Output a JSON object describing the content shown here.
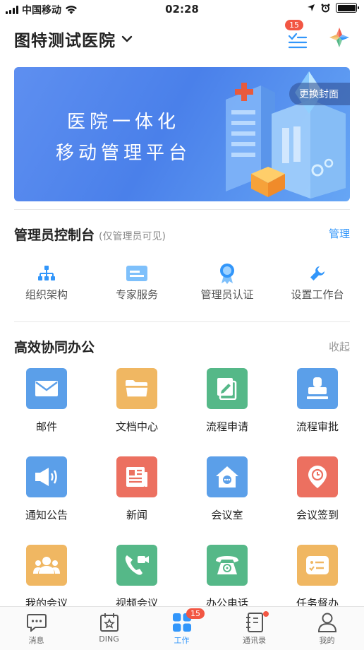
{
  "status_bar": {
    "carrier": "中国移动",
    "time": "02:28"
  },
  "header": {
    "org_name": "图特测试医院",
    "todo_badge": "15"
  },
  "banner": {
    "title_line1": "医院一体化",
    "title_line2": "移动管理平台",
    "change_cover": "更换封面"
  },
  "admin": {
    "title": "管理员控制台",
    "subtitle": "(仅管理员可见)",
    "manage": "管理",
    "items": [
      {
        "label": "组织架构",
        "icon": "org-chart-icon"
      },
      {
        "label": "专家服务",
        "icon": "card-icon"
      },
      {
        "label": "管理员认证",
        "icon": "badge-icon"
      },
      {
        "label": "设置工作台",
        "icon": "wrench-icon"
      }
    ]
  },
  "collab": {
    "title": "高效协同办公",
    "collapse": "收起",
    "apps": [
      {
        "label": "邮件",
        "icon": "mail-icon",
        "color": "#5b9fe9"
      },
      {
        "label": "文档中心",
        "icon": "folder-icon",
        "color": "#f0b762"
      },
      {
        "label": "流程申请",
        "icon": "edit-doc-icon",
        "color": "#55b888"
      },
      {
        "label": "流程审批",
        "icon": "stamp-icon",
        "color": "#5b9fe9"
      },
      {
        "label": "通知公告",
        "icon": "megaphone-icon",
        "color": "#5b9fe9"
      },
      {
        "label": "新闻",
        "icon": "newspaper-icon",
        "color": "#ec7060"
      },
      {
        "label": "会议室",
        "icon": "meeting-room-icon",
        "color": "#5b9fe9"
      },
      {
        "label": "会议签到",
        "icon": "location-clock-icon",
        "color": "#ec7060"
      },
      {
        "label": "我的会议",
        "icon": "people-icon",
        "color": "#f0b762"
      },
      {
        "label": "视频会议",
        "icon": "video-call-icon",
        "color": "#55b888"
      },
      {
        "label": "办公电话",
        "icon": "phone-icon",
        "color": "#55b888"
      },
      {
        "label": "任务督办",
        "icon": "task-list-icon",
        "color": "#f0b762"
      }
    ]
  },
  "tabbar": {
    "tabs": [
      {
        "label": "消息",
        "icon": "chat-icon"
      },
      {
        "label": "DING",
        "icon": "ding-icon"
      },
      {
        "label": "工作",
        "icon": "grid-icon",
        "badge": "15"
      },
      {
        "label": "通讯录",
        "icon": "contacts-icon"
      },
      {
        "label": "我的",
        "icon": "person-icon"
      }
    ]
  },
  "colors": {
    "accent": "#3296fa",
    "badge": "#f25643"
  }
}
